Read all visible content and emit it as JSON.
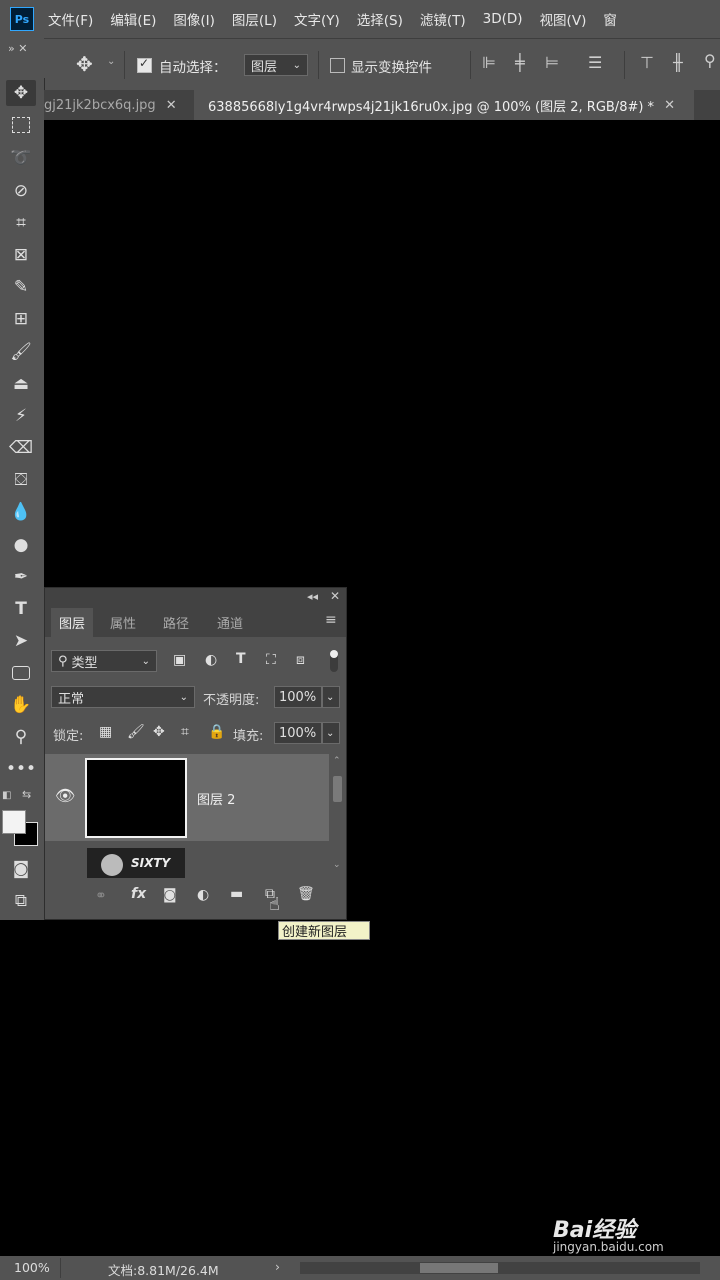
{
  "app": {
    "logo": "Ps"
  },
  "menu": [
    "文件(F)",
    "编辑(E)",
    "图像(I)",
    "图层(L)",
    "文字(Y)",
    "选择(S)",
    "滤镜(T)",
    "3D(D)",
    "视图(V)",
    "窗"
  ],
  "options": {
    "auto_select_label": "自动选择：",
    "auto_select_value": "图层",
    "show_transform_label": "显示变换控件",
    "auto_select_checked": true,
    "show_transform_checked": false
  },
  "tabs": [
    {
      "label": "gj21jk2bcx6q.jpg",
      "active": false
    },
    {
      "label": "63885668ly1g4vr4rwps4j21jk16ru0x.jpg @ 100% (图层 2, RGB/8#) *",
      "active": true
    }
  ],
  "tools": [
    "move-icon",
    "marquee-icon",
    "lasso-icon",
    "quick-select-icon",
    "crop-icon",
    "frame-icon",
    "eyedropper-icon",
    "healing-icon",
    "brush-icon",
    "stamp-icon",
    "history-brush-icon",
    "eraser-icon",
    "paint-bucket-icon",
    "blur-icon",
    "dodge-icon",
    "pen-icon",
    "type-icon",
    "path-select-icon",
    "shape-icon",
    "hand-icon",
    "zoom-icon",
    "more-icon"
  ],
  "layers_panel": {
    "tabs": [
      "图层",
      "属性",
      "路径",
      "通道"
    ],
    "filter_label": "类型",
    "blend_mode": "正常",
    "opacity_label": "不透明度:",
    "opacity_value": "100%",
    "lock_label": "锁定:",
    "fill_label": "填充:",
    "fill_value": "100%",
    "layers": [
      {
        "name": "图层 2",
        "selected": true
      },
      {
        "name": "",
        "thumbnail_text": "SIXTY",
        "selected": false
      }
    ]
  },
  "tooltip": "创建新图层",
  "status": {
    "zoom": "100%",
    "doc": "文档:8.81M/26.4M"
  },
  "watermark": {
    "brand": "Bai经验",
    "url": "jingyan.baidu.com"
  }
}
